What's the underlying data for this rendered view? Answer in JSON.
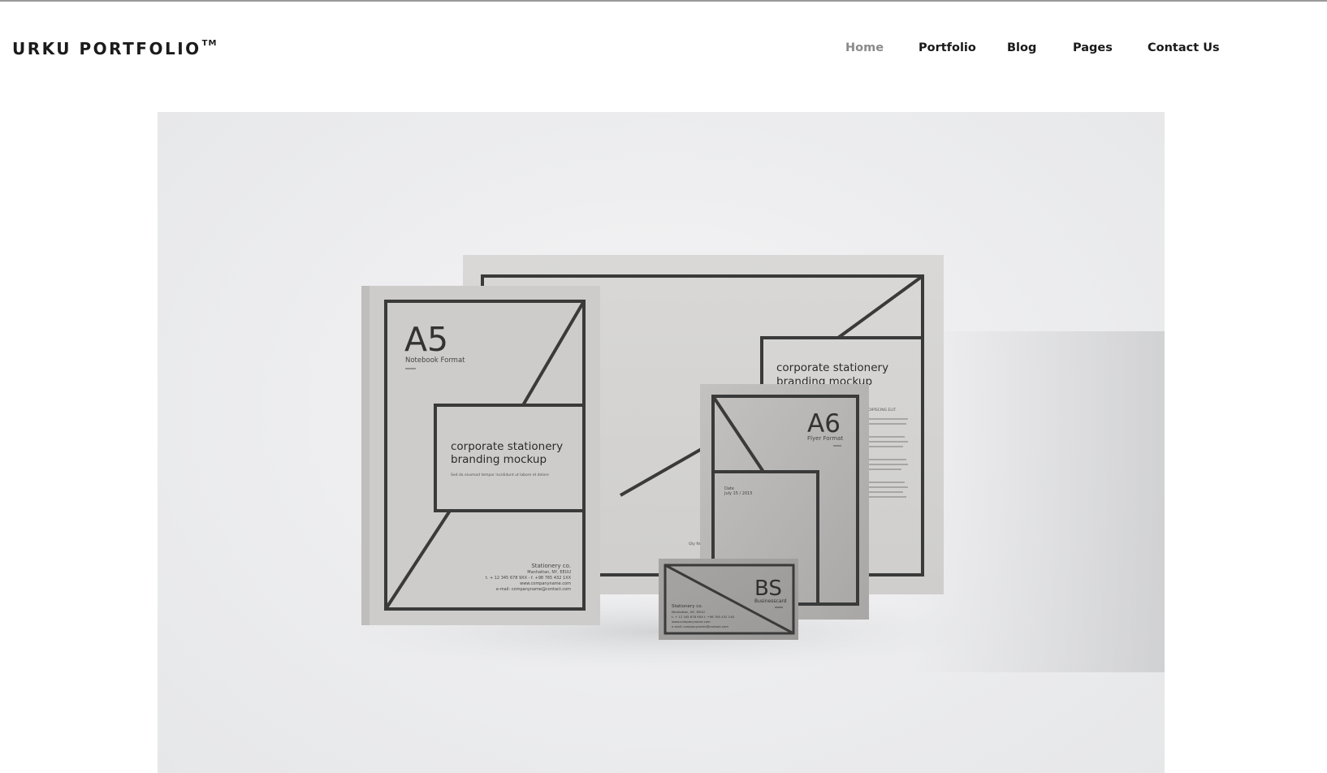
{
  "header": {
    "brand": "URKU PORTFOLIO",
    "brand_mark": "TM",
    "nav": [
      {
        "label": "Home",
        "active": true
      },
      {
        "label": "Portfolio",
        "active": false
      },
      {
        "label": "Blog",
        "active": false
      },
      {
        "label": "Pages",
        "active": false
      },
      {
        "label": "Contact Us",
        "active": false
      }
    ]
  },
  "hero_image": {
    "notebook": {
      "size": "A5",
      "format": "Notebook Format",
      "title_line1": "corporate stationery",
      "title_line2": "branding mockup",
      "tagline": "Sed do eiusmod tempor incididunt ut labore et dolore",
      "company": "Stationery co.",
      "address": "Manhattan, NY, EEUU",
      "phones": "t. + 12 345 678 9XX  -  f. +98 765 432 1XX",
      "web": "www.companyname.com",
      "email": "e-mail: companyname@contact.com"
    },
    "letterhead": {
      "title_line1": "corporate stationery",
      "title_line2": "branding mockup",
      "kicker": "ADIPISCING ELIT."
    },
    "flyer": {
      "size": "A6",
      "format": "Flyer Format",
      "date_label": "Date",
      "date_value": "July 15 / 2015",
      "field": "Qty Nr."
    },
    "business_card": {
      "size": "BS",
      "format": "Businesscard",
      "company": "Stationery co.",
      "address": "Manhattan, NY, EEUU",
      "phones": "t. + 12 345 678 9XX     f. +98 765 432 1XX",
      "web": "www.companyname.com",
      "email": "e-mail: companyname@contact.com"
    }
  }
}
